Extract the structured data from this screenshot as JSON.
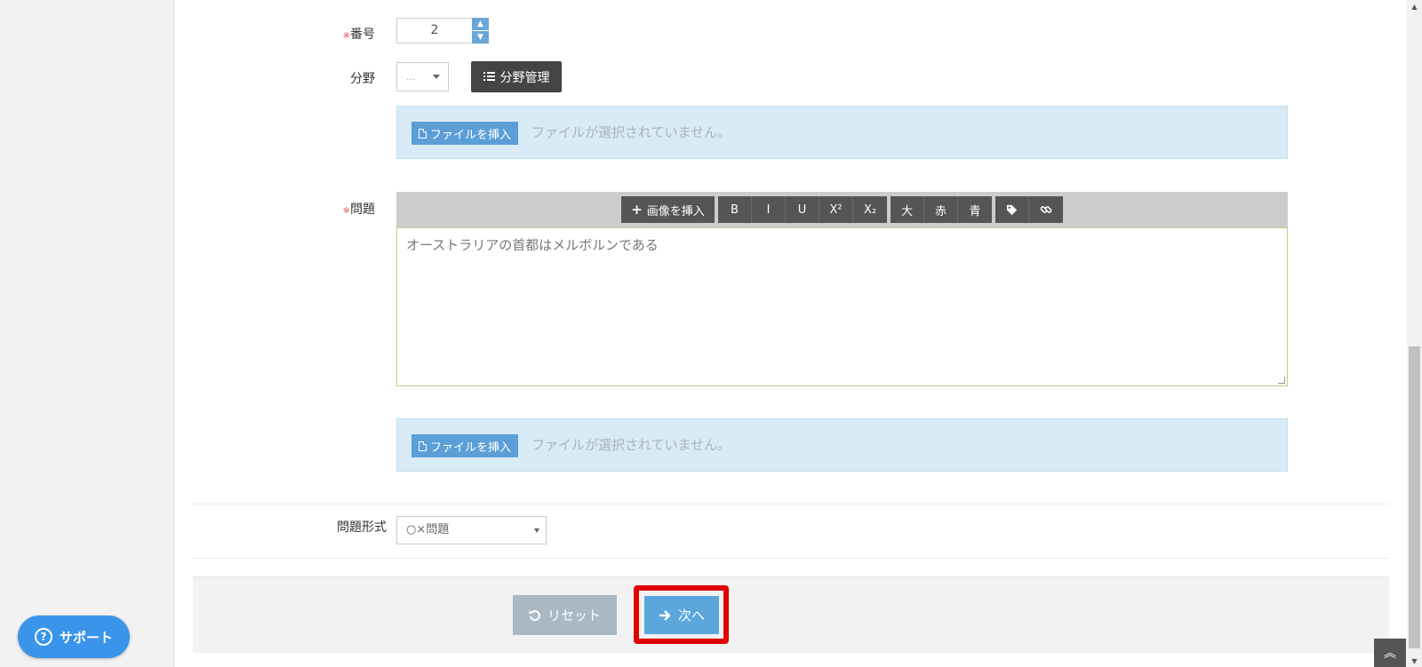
{
  "form": {
    "number": {
      "label": "番号",
      "required_mark": "※",
      "value": "2"
    },
    "category": {
      "label": "分野",
      "selected": "...",
      "manage_label": "分野管理"
    },
    "file_top": {
      "button_label": "ファイルを挿入",
      "status": "ファイルが選択されていません。"
    },
    "question": {
      "label": "問題",
      "required_mark": "※",
      "text": "オーストラリアの首都はメルボルンである",
      "toolbar": {
        "insert_image": "画像を挿入",
        "bold": "B",
        "italic": "I",
        "underline": "U",
        "superscript": "X²",
        "subscript": "X₂",
        "large": "大",
        "red": "赤",
        "blue": "青"
      }
    },
    "file_bottom": {
      "button_label": "ファイルを挿入",
      "status": "ファイルが選択されていません。"
    },
    "question_type": {
      "label": "問題形式",
      "selected": "○×問題"
    }
  },
  "actions": {
    "reset_label": "リセット",
    "next_label": "次へ"
  },
  "support": {
    "label": "サポート"
  },
  "colors": {
    "accent": "#5ba6dd",
    "highlight": "#e00000",
    "dark_button": "#444444"
  }
}
